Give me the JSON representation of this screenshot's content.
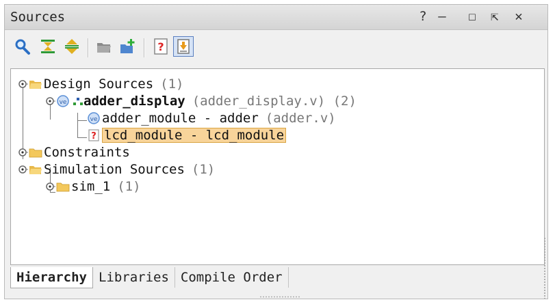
{
  "panel": {
    "title": "Sources",
    "controls": {
      "help": "?",
      "minimize": "—",
      "maximize": "☐",
      "float": "⇱",
      "close": "✕"
    }
  },
  "toolbar": {
    "buttons": [
      {
        "icon": "search-icon"
      },
      {
        "icon": "collapse-all-icon"
      },
      {
        "icon": "expand-all-icon"
      },
      {
        "icon": "open-folder-icon"
      },
      {
        "icon": "add-sources-icon"
      },
      {
        "icon": "help-icon"
      },
      {
        "icon": "auto-update-icon",
        "pressed": true
      }
    ]
  },
  "tree": {
    "design_sources": {
      "label": "Design Sources",
      "meta": "(1)"
    },
    "adder_display": {
      "label": "adder_display",
      "meta": "(adder_display.v) (2)"
    },
    "adder_module": {
      "label": "adder_module - adder",
      "meta": "(adder.v)"
    },
    "lcd_module": {
      "label": "lcd_module - lcd_module"
    },
    "constraints": {
      "label": "Constraints"
    },
    "simulation_sources": {
      "label": "Simulation Sources",
      "meta": "(1)"
    },
    "sim_1": {
      "label": "sim_1",
      "meta": "(1)"
    }
  },
  "tabs": [
    {
      "label": "Hierarchy",
      "active": true
    },
    {
      "label": "Libraries"
    },
    {
      "label": "Compile Order"
    }
  ],
  "colors": {
    "selection": "#f8d49a",
    "folder": "#f5c85a",
    "verilog_icon": "#5b8fd6"
  }
}
